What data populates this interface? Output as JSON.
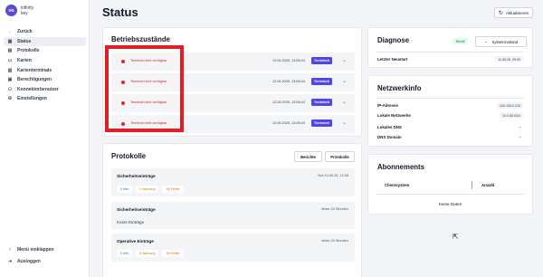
{
  "app": {
    "logo_mark": "oo",
    "logo_line1": "infinity",
    "logo_line2": "key"
  },
  "sidebar": {
    "items": [
      {
        "label": "Zurück",
        "icon": "arrow-left-icon",
        "glyph": "←"
      },
      {
        "label": "Status",
        "icon": "grid-icon",
        "glyph": "▦",
        "active": true
      },
      {
        "label": "Protokolle",
        "icon": "document-icon",
        "glyph": "▤"
      },
      {
        "label": "Karten",
        "icon": "cards-icon",
        "glyph": "▭"
      },
      {
        "label": "Kartenterminals",
        "icon": "terminal-icon",
        "glyph": "▥"
      },
      {
        "label": "Berechtigungen",
        "icon": "permissions-icon",
        "glyph": "▣"
      },
      {
        "label": "Konnektorbenutzer",
        "icon": "users-icon",
        "glyph": "⚇"
      },
      {
        "label": "Einstellungen",
        "icon": "gear-icon",
        "glyph": "⚙"
      }
    ],
    "bottom": [
      {
        "label": "Menü einklappen",
        "icon": "collapse-icon",
        "glyph": "‹"
      },
      {
        "label": "Ausloggen",
        "icon": "logout-icon",
        "glyph": "⇥"
      }
    ]
  },
  "header": {
    "title": "Status",
    "refresh_label": "Aktualisieren"
  },
  "betrieb": {
    "title": "Betriebszustände",
    "rows": [
      {
        "message": "Terminal nicht verfügbar",
        "timestamp": "12.06.2025, 13:06:44",
        "badge": "Technisch"
      },
      {
        "message": "Terminal nicht verfügbar",
        "timestamp": "12.06.2025, 13:06:44",
        "badge": "Technisch"
      },
      {
        "message": "Terminal nicht verfügbar",
        "timestamp": "12.06.2025, 13:06:44",
        "badge": "Technisch"
      },
      {
        "message": "Terminal nicht verfügbar",
        "timestamp": "12.06.2025, 13:06:44",
        "badge": "Technisch"
      }
    ]
  },
  "protokolle": {
    "title": "Protokolle",
    "tab_reports": "Berichte",
    "tab_logs": "Protokolle",
    "items": [
      {
        "title": "Sicherheitseinträge",
        "range": "Seit 14.06.25, 12:08",
        "info": "0 Info",
        "warn": "1 Warnung",
        "err": "44 Fehler"
      },
      {
        "title": "Sicherheitseinträge",
        "range": "letzte 24 Stunden",
        "empty": "Keine Einträge"
      },
      {
        "title": "Operative Einträge",
        "range": "letzte 24 Stunden",
        "info": "0 Info",
        "warn": "5 Warnung",
        "err": "39 Fehler"
      }
    ]
  },
  "diagnose": {
    "title": "Diagnose",
    "status_pill": "Bereit",
    "select_label": "Systemzustand",
    "restart_label": "Letzter Neustart",
    "restart_value": "11.06.25, 09:00"
  },
  "netzwerk": {
    "title": "Netzwerkinfo",
    "ip_label": "IP-Adresse",
    "ip_value": "100.106.0.215",
    "local_label": "Lokale Netzwerke",
    "local_value": "10.3.55.0/24",
    "dns_label": "Lokales DNS",
    "dns_value": "--",
    "domain_label": "DNS Domain",
    "domain_value": "--"
  },
  "abonnements": {
    "title": "Abonnements",
    "col_client": "Clientsystem",
    "col_count": "Anzahl",
    "no_data": "Keine Daten"
  },
  "colors": {
    "accent": "#4f46e5",
    "error": "#dc2626",
    "highlight": "#e11d26"
  }
}
